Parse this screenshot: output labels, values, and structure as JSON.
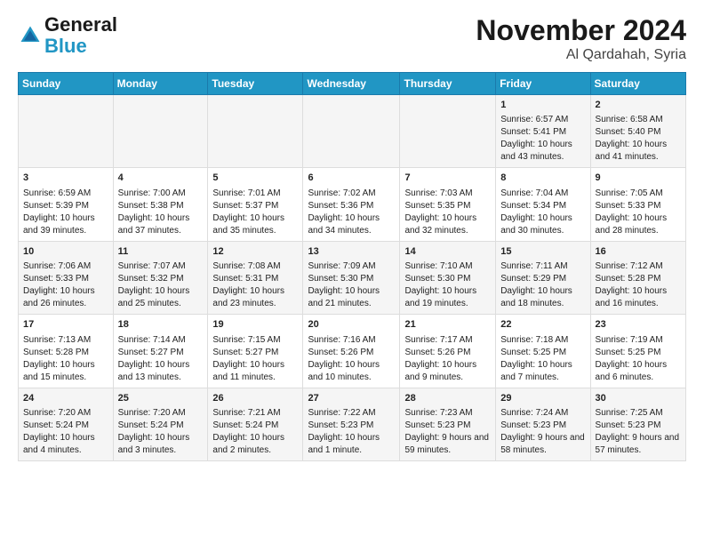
{
  "logo": {
    "line1": "General",
    "line2": "Blue"
  },
  "title": "November 2024",
  "location": "Al Qardahah, Syria",
  "headers": [
    "Sunday",
    "Monday",
    "Tuesday",
    "Wednesday",
    "Thursday",
    "Friday",
    "Saturday"
  ],
  "weeks": [
    [
      {
        "day": "",
        "info": ""
      },
      {
        "day": "",
        "info": ""
      },
      {
        "day": "",
        "info": ""
      },
      {
        "day": "",
        "info": ""
      },
      {
        "day": "",
        "info": ""
      },
      {
        "day": "1",
        "info": "Sunrise: 6:57 AM\nSunset: 5:41 PM\nDaylight: 10 hours and 43 minutes."
      },
      {
        "day": "2",
        "info": "Sunrise: 6:58 AM\nSunset: 5:40 PM\nDaylight: 10 hours and 41 minutes."
      }
    ],
    [
      {
        "day": "3",
        "info": "Sunrise: 6:59 AM\nSunset: 5:39 PM\nDaylight: 10 hours and 39 minutes."
      },
      {
        "day": "4",
        "info": "Sunrise: 7:00 AM\nSunset: 5:38 PM\nDaylight: 10 hours and 37 minutes."
      },
      {
        "day": "5",
        "info": "Sunrise: 7:01 AM\nSunset: 5:37 PM\nDaylight: 10 hours and 35 minutes."
      },
      {
        "day": "6",
        "info": "Sunrise: 7:02 AM\nSunset: 5:36 PM\nDaylight: 10 hours and 34 minutes."
      },
      {
        "day": "7",
        "info": "Sunrise: 7:03 AM\nSunset: 5:35 PM\nDaylight: 10 hours and 32 minutes."
      },
      {
        "day": "8",
        "info": "Sunrise: 7:04 AM\nSunset: 5:34 PM\nDaylight: 10 hours and 30 minutes."
      },
      {
        "day": "9",
        "info": "Sunrise: 7:05 AM\nSunset: 5:33 PM\nDaylight: 10 hours and 28 minutes."
      }
    ],
    [
      {
        "day": "10",
        "info": "Sunrise: 7:06 AM\nSunset: 5:33 PM\nDaylight: 10 hours and 26 minutes."
      },
      {
        "day": "11",
        "info": "Sunrise: 7:07 AM\nSunset: 5:32 PM\nDaylight: 10 hours and 25 minutes."
      },
      {
        "day": "12",
        "info": "Sunrise: 7:08 AM\nSunset: 5:31 PM\nDaylight: 10 hours and 23 minutes."
      },
      {
        "day": "13",
        "info": "Sunrise: 7:09 AM\nSunset: 5:30 PM\nDaylight: 10 hours and 21 minutes."
      },
      {
        "day": "14",
        "info": "Sunrise: 7:10 AM\nSunset: 5:30 PM\nDaylight: 10 hours and 19 minutes."
      },
      {
        "day": "15",
        "info": "Sunrise: 7:11 AM\nSunset: 5:29 PM\nDaylight: 10 hours and 18 minutes."
      },
      {
        "day": "16",
        "info": "Sunrise: 7:12 AM\nSunset: 5:28 PM\nDaylight: 10 hours and 16 minutes."
      }
    ],
    [
      {
        "day": "17",
        "info": "Sunrise: 7:13 AM\nSunset: 5:28 PM\nDaylight: 10 hours and 15 minutes."
      },
      {
        "day": "18",
        "info": "Sunrise: 7:14 AM\nSunset: 5:27 PM\nDaylight: 10 hours and 13 minutes."
      },
      {
        "day": "19",
        "info": "Sunrise: 7:15 AM\nSunset: 5:27 PM\nDaylight: 10 hours and 11 minutes."
      },
      {
        "day": "20",
        "info": "Sunrise: 7:16 AM\nSunset: 5:26 PM\nDaylight: 10 hours and 10 minutes."
      },
      {
        "day": "21",
        "info": "Sunrise: 7:17 AM\nSunset: 5:26 PM\nDaylight: 10 hours and 9 minutes."
      },
      {
        "day": "22",
        "info": "Sunrise: 7:18 AM\nSunset: 5:25 PM\nDaylight: 10 hours and 7 minutes."
      },
      {
        "day": "23",
        "info": "Sunrise: 7:19 AM\nSunset: 5:25 PM\nDaylight: 10 hours and 6 minutes."
      }
    ],
    [
      {
        "day": "24",
        "info": "Sunrise: 7:20 AM\nSunset: 5:24 PM\nDaylight: 10 hours and 4 minutes."
      },
      {
        "day": "25",
        "info": "Sunrise: 7:20 AM\nSunset: 5:24 PM\nDaylight: 10 hours and 3 minutes."
      },
      {
        "day": "26",
        "info": "Sunrise: 7:21 AM\nSunset: 5:24 PM\nDaylight: 10 hours and 2 minutes."
      },
      {
        "day": "27",
        "info": "Sunrise: 7:22 AM\nSunset: 5:23 PM\nDaylight: 10 hours and 1 minute."
      },
      {
        "day": "28",
        "info": "Sunrise: 7:23 AM\nSunset: 5:23 PM\nDaylight: 9 hours and 59 minutes."
      },
      {
        "day": "29",
        "info": "Sunrise: 7:24 AM\nSunset: 5:23 PM\nDaylight: 9 hours and 58 minutes."
      },
      {
        "day": "30",
        "info": "Sunrise: 7:25 AM\nSunset: 5:23 PM\nDaylight: 9 hours and 57 minutes."
      }
    ]
  ]
}
